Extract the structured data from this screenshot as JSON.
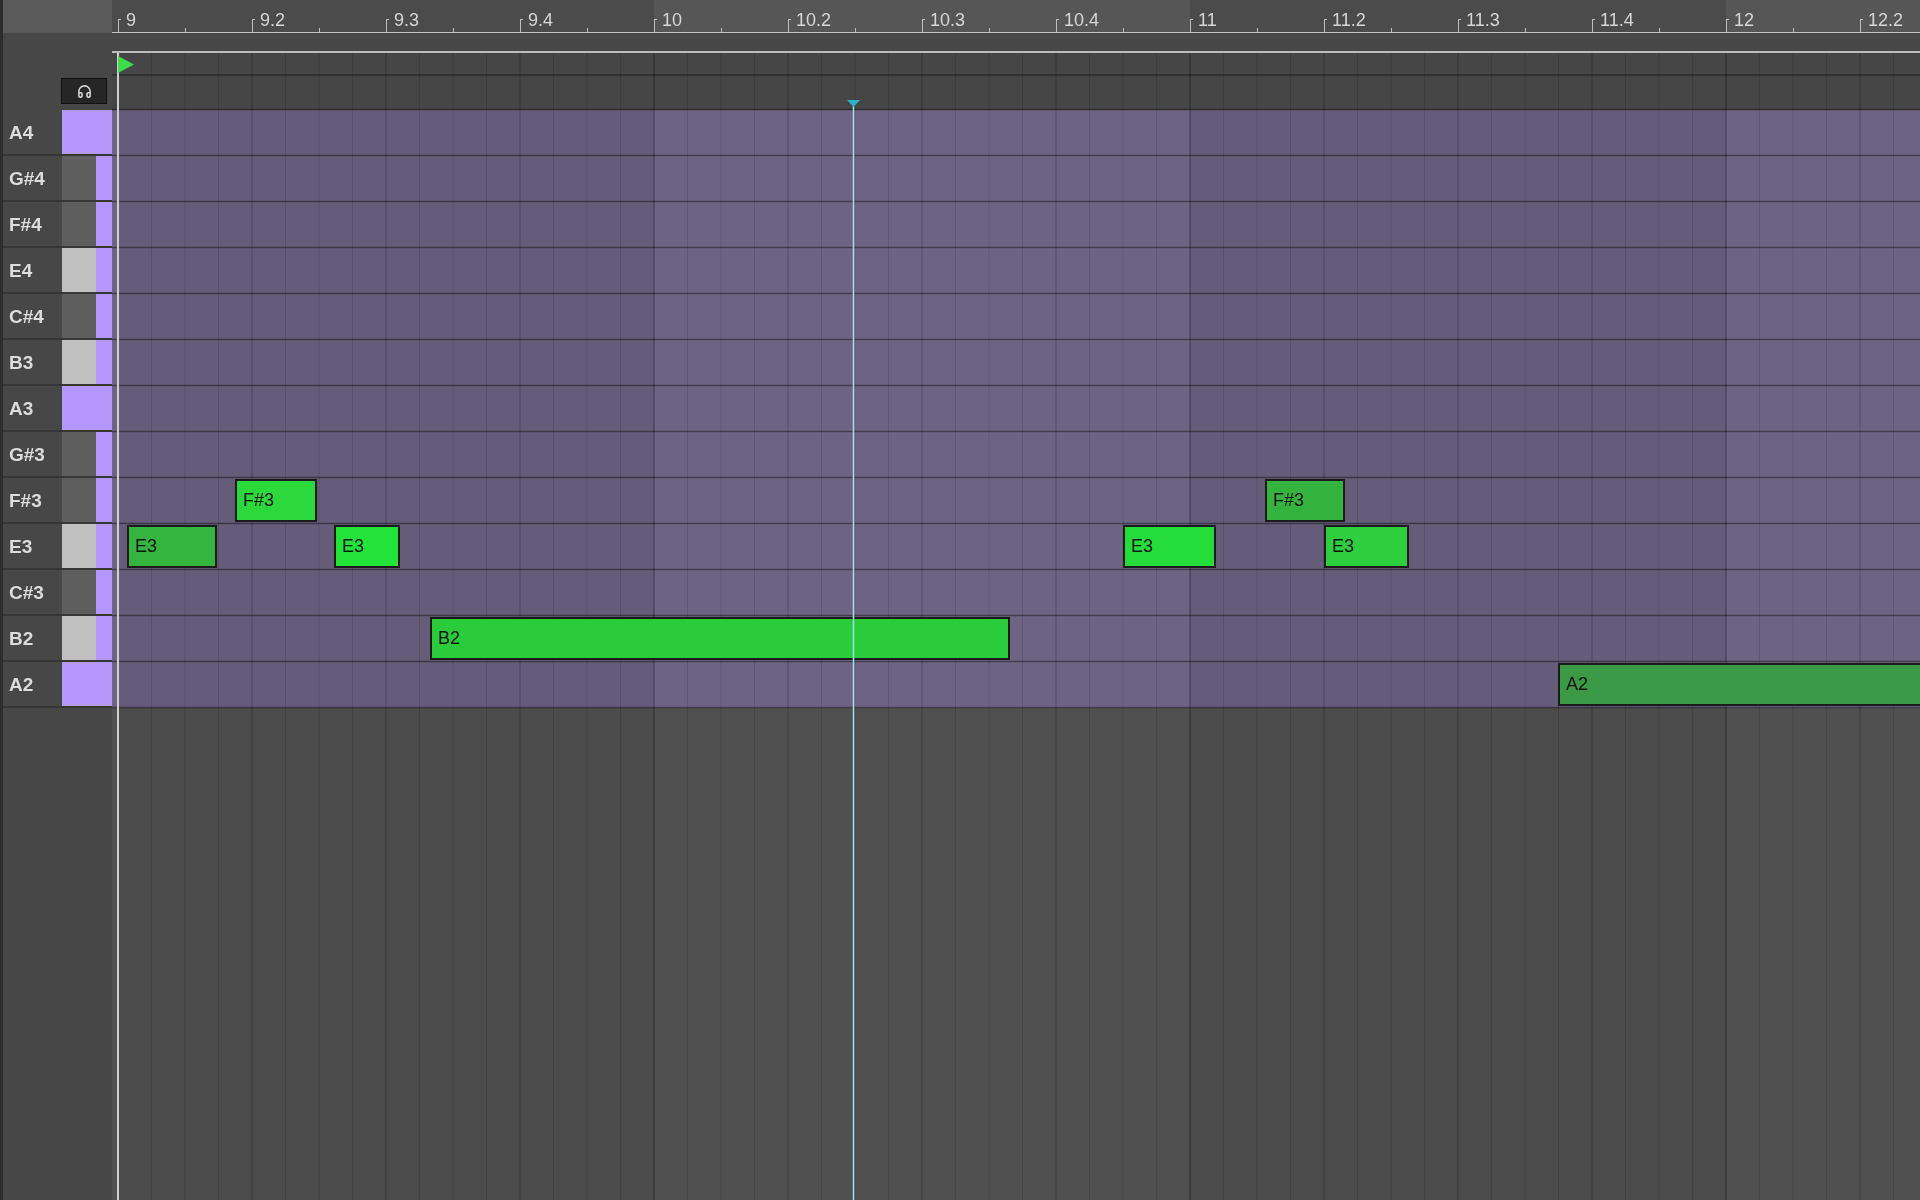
{
  "ruler": {
    "marks": [
      "9",
      "9.2",
      "9.3",
      "9.4",
      "10",
      "10.2",
      "10.3",
      "10.4",
      "11",
      "11.2",
      "11.3",
      "11.4",
      "12",
      "12.2"
    ]
  },
  "rows": [
    {
      "label": "A4",
      "kind": "root"
    },
    {
      "label": "G#4",
      "kind": "black"
    },
    {
      "label": "F#4",
      "kind": "black"
    },
    {
      "label": "E4",
      "kind": "white"
    },
    {
      "label": "C#4",
      "kind": "black"
    },
    {
      "label": "B3",
      "kind": "white"
    },
    {
      "label": "A3",
      "kind": "root"
    },
    {
      "label": "G#3",
      "kind": "black"
    },
    {
      "label": "F#3",
      "kind": "black",
      "notes": [
        {
          "label": "F#3",
          "color": "#2bd93d"
        },
        {
          "label": "F#3",
          "color": "#34b43f"
        }
      ]
    },
    {
      "label": "E3",
      "kind": "white",
      "notes": [
        {
          "label": "E3",
          "color": "#33b540"
        },
        {
          "label": "E3",
          "color": "#22e33a"
        },
        {
          "label": "E3",
          "color": "#24dc3a"
        },
        {
          "label": "E3",
          "color": "#2ecf3e"
        }
      ]
    },
    {
      "label": "C#3",
      "kind": "black"
    },
    {
      "label": "B2",
      "kind": "white",
      "notes": [
        {
          "label": "B2",
          "color": "#2bcc3b"
        }
      ]
    },
    {
      "label": "A2",
      "kind": "root",
      "notes": [
        {
          "label": "A2",
          "color": "#3b9a45"
        }
      ]
    }
  ]
}
